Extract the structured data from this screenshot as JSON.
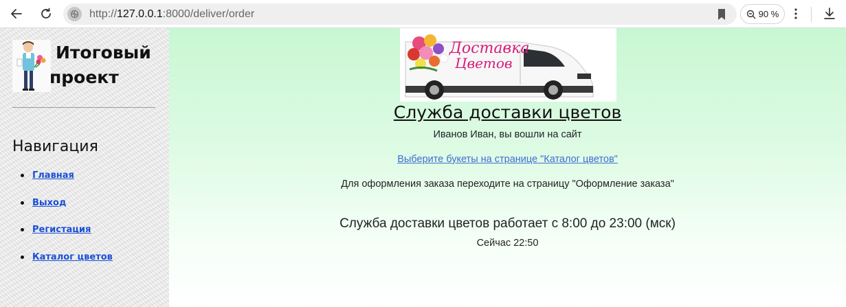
{
  "browser": {
    "url_prefix": "http://",
    "url_host": "127.0.0.1",
    "url_rest": ":8000/deliver/order",
    "zoom": "90 %"
  },
  "sidebar": {
    "project_title_line1": "Итоговый",
    "project_title_line2": "проект",
    "nav_heading": "Навигация",
    "nav_items": [
      {
        "label": "Главная"
      },
      {
        "label": "Выход"
      },
      {
        "label": "Регистация"
      },
      {
        "label": "Каталог цветов"
      }
    ]
  },
  "main": {
    "banner_text_line1": "Доставка",
    "banner_text_line2": "Цветов",
    "title": "Служба доставки цветов",
    "logged_in": "Иванов Иван, вы вошли на сайт",
    "catalog_link": "Выберите букеты на странице \"Каталог цветов\"",
    "order_note": "Для оформления заказа переходите на страницу \"Оформление заказа\"",
    "hours": "Служба доставки цветов работает с 8:00 до 23:00 (мск)",
    "now": "Сейчас 22:50"
  },
  "colors": {
    "link": "#1a4fd6",
    "main_bg_top": "#c8f7d3",
    "banner_text": "#d81b7a"
  }
}
